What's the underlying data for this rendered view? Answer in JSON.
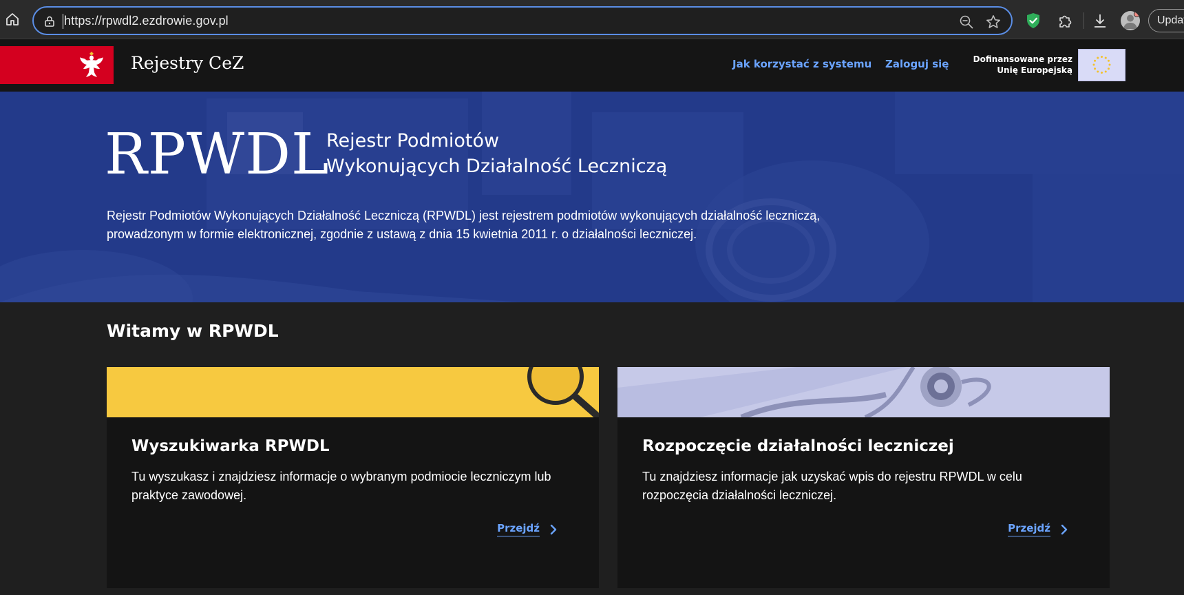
{
  "browser": {
    "url": "https://rpwdl2.ezdrowie.gov.pl",
    "update_label": "Updat",
    "icons": [
      "home-icon",
      "lock-icon",
      "zoom-out-icon",
      "star-icon",
      "shield-extension-icon",
      "puzzle-icon",
      "download-icon",
      "profile-avatar"
    ]
  },
  "header": {
    "site_name": "Rejestry CeZ",
    "nav": {
      "how_to": "Jak korzystać z systemu",
      "login": "Zaloguj się"
    },
    "eu_line1": "Dofinansowane przez",
    "eu_line2": "Unię Europejską"
  },
  "hero": {
    "acronym": "RPWDL",
    "subtitle_line1": "Rejestr Podmiotów",
    "subtitle_line2": "Wykonujących Działalność Leczniczą",
    "description": "Rejestr Podmiotów Wykonujących Działalność Leczniczą (RPWDL) jest rejestrem podmiotów wykonujących działalność leczniczą, prowadzonym w formie elektronicznej, zgodnie z ustawą z dnia 15 kwietnia 2011 r. o działalności leczniczej."
  },
  "welcome": {
    "title": "Witamy w RPWDL",
    "cards": [
      {
        "title": "Wyszukiwarka RPWDL",
        "description": "Tu wyszukasz i znajdziesz informacje o wybranym podmiocie leczniczym lub praktyce zawodowej.",
        "link": "Przejdź"
      },
      {
        "title": "Rozpoczęcie działalności leczniczej",
        "description": "Tu znajdziesz informacje jak uzyskać wpis do rejestru RPWDL w celu rozpoczęcia działalności leczniczej.",
        "link": "Przejdź"
      }
    ]
  },
  "colors": {
    "flag_red": "#d4001f",
    "hero_blue": "#233a8a",
    "link_blue": "#6ba4ff",
    "card_yellow": "#f7c940",
    "card_lavender": "#c6c9e8",
    "page_bg": "#1f1f1f"
  }
}
